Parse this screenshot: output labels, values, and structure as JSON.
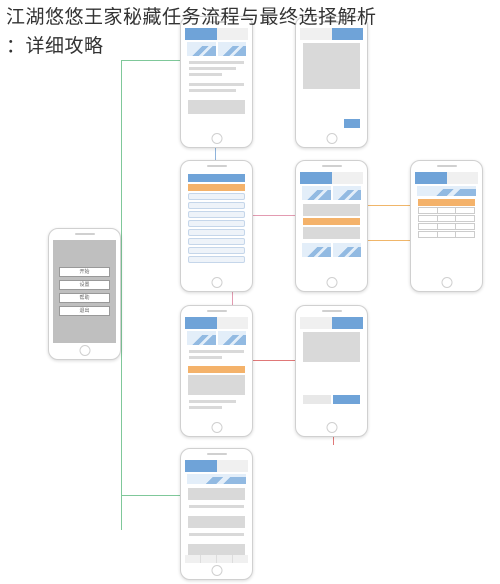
{
  "title_line1": "江湖悠悠王家秘藏任务流程与最终选择解析",
  "title_line2": "：详细攻略",
  "menu": {
    "items": [
      "开始",
      "设置",
      "帮助",
      "退出"
    ]
  },
  "watermark": ""
}
